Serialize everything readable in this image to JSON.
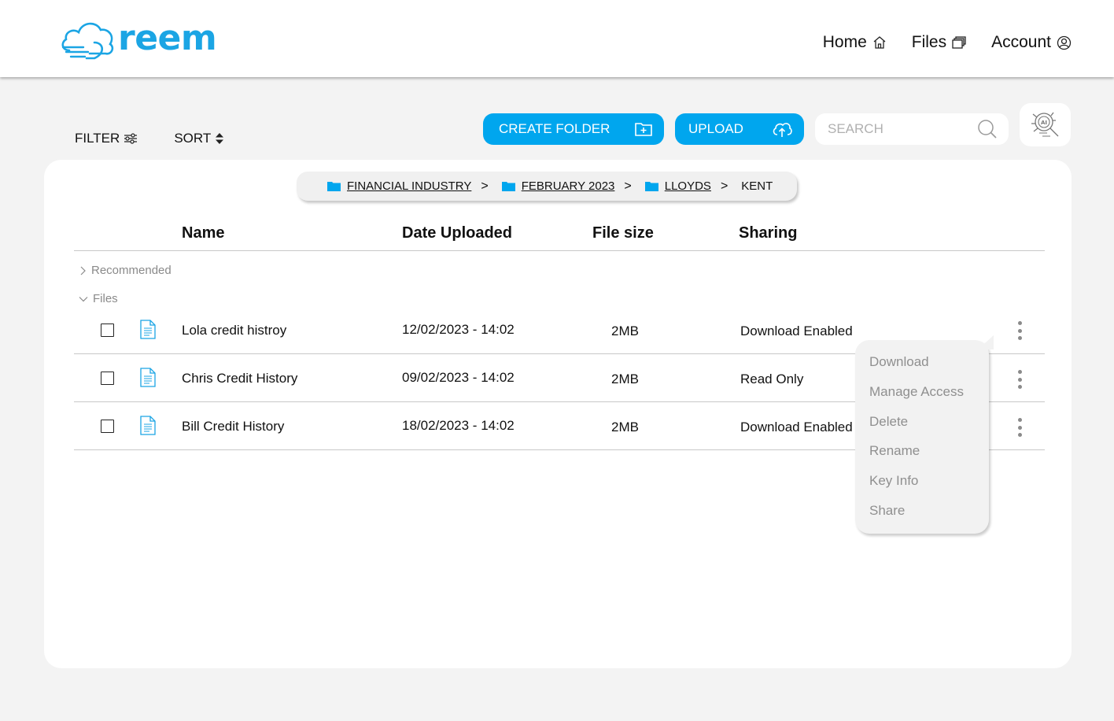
{
  "brand": {
    "name": "reem",
    "color": "#1ba5e4"
  },
  "nav": [
    {
      "label": "Home",
      "icon": "home-icon"
    },
    {
      "label": "Files",
      "icon": "files-icon"
    },
    {
      "label": "Account",
      "icon": "account-icon"
    }
  ],
  "toolbar": {
    "filter_label": "FILTER",
    "sort_label": "SORT",
    "create_folder_label": "CREATE FOLDER",
    "upload_label": "UPLOAD",
    "search_placeholder": "SEARCH",
    "accent": "#00a6ee"
  },
  "breadcrumb": [
    {
      "label": "FINANCIAL INDUSTRY",
      "icon": "folder-icon"
    },
    {
      "label": "FEBRUARY 2023",
      "icon": "folder-icon"
    },
    {
      "label": "LLOYDS",
      "icon": "folder-icon"
    },
    {
      "label": "KENT"
    }
  ],
  "table": {
    "columns": [
      "Name",
      "Date Uploaded",
      "File size",
      "Sharing"
    ],
    "groups": {
      "recommended": "Recommended",
      "files": "Files"
    },
    "rows": [
      {
        "name": "Lola credit histroy",
        "date": "12/02/2023 - 14:02",
        "size": "2MB",
        "sharing": "Download Enabled"
      },
      {
        "name": "Chris Credit History",
        "date": "09/02/2023 - 14:02",
        "size": "2MB",
        "sharing": "Read Only"
      },
      {
        "name": "Bill Credit History",
        "date": "18/02/2023 - 14:02",
        "size": "2MB",
        "sharing": "Download Enabled"
      }
    ]
  },
  "context_menu": {
    "items": [
      "Download",
      "Manage Access",
      "Delete",
      "Rename",
      "Key Info",
      "Share"
    ]
  }
}
